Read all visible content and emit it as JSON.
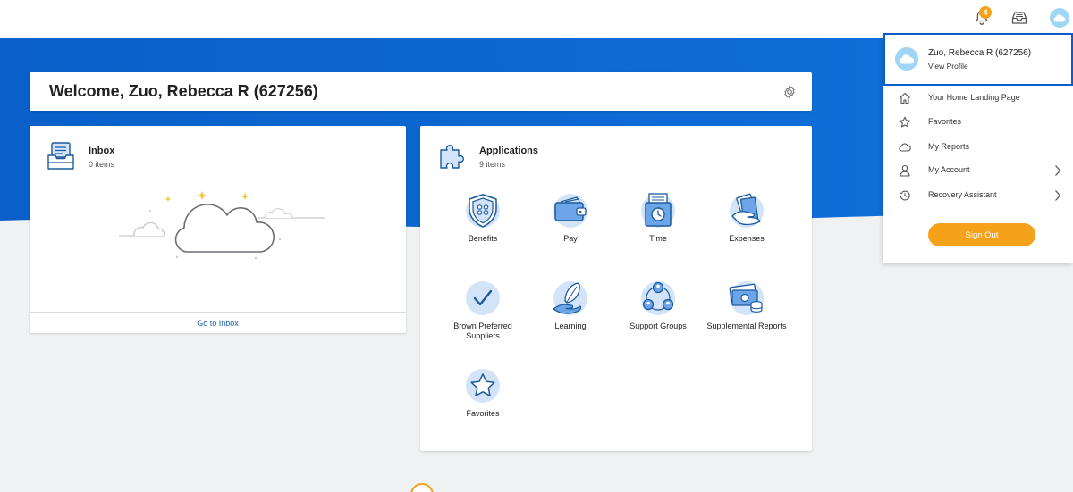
{
  "topbar": {
    "notification_count": "4",
    "icons": [
      "bell-icon",
      "inbox-tray-icon",
      "user-avatar-icon"
    ]
  },
  "welcome": {
    "title": "Welcome, Zuo, Rebecca R (627256)",
    "settings_icon": "gear-icon"
  },
  "inbox": {
    "title": "Inbox",
    "count": "0 items",
    "footer_link": "Go to Inbox"
  },
  "applications": {
    "title": "Applications",
    "count": "9 items",
    "items": [
      {
        "label": "Benefits",
        "icon": "shield-icon"
      },
      {
        "label": "Pay",
        "icon": "wallet-icon"
      },
      {
        "label": "Time",
        "icon": "timeclock-icon"
      },
      {
        "label": "Expenses",
        "icon": "receipt-hand-icon"
      },
      {
        "label": "Brown Preferred Suppliers",
        "icon": "checkmark-icon"
      },
      {
        "label": "Learning",
        "icon": "feather-hand-icon"
      },
      {
        "label": "Support Groups",
        "icon": "people-group-icon"
      },
      {
        "label": "Supplemental Reports",
        "icon": "money-stack-icon"
      },
      {
        "label": "Favorites",
        "icon": "star-icon"
      }
    ]
  },
  "profile_menu": {
    "name": "Zuo, Rebecca R (627256)",
    "view_profile": "View Profile",
    "items": [
      {
        "label": "Your Home Landing Page",
        "icon": "home-icon"
      },
      {
        "label": "Favorites",
        "icon": "star-outline-icon"
      },
      {
        "label": "My Reports",
        "icon": "cloud-icon"
      },
      {
        "label": "My Account",
        "icon": "person-icon",
        "has_submenu": true
      },
      {
        "label": "Recovery Assistant",
        "icon": "history-icon",
        "has_submenu": true
      }
    ],
    "sign_out": "Sign Out"
  },
  "colors": {
    "brand_blue": "#0b5ec7",
    "accent_orange": "#f6a11a",
    "icon_bg": "#d3e4f8",
    "icon_stroke": "#1c5a9e"
  }
}
